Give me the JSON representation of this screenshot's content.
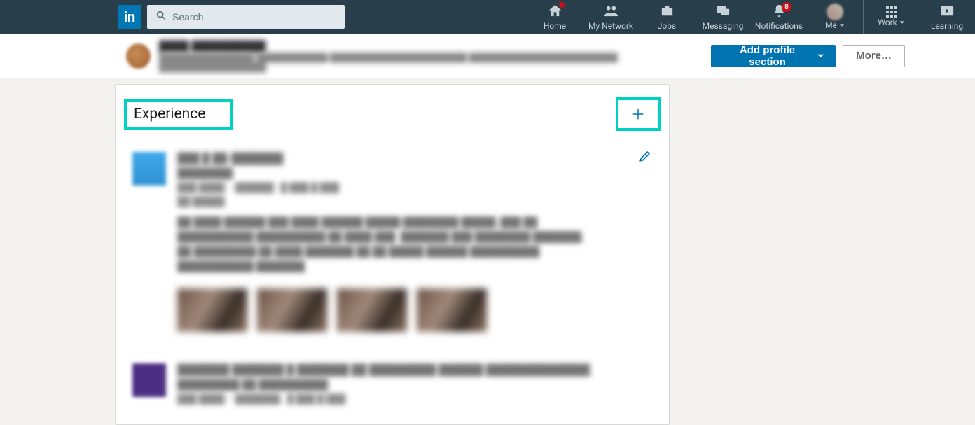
{
  "nav": {
    "logo_text": "in",
    "search_placeholder": "Search",
    "items": [
      {
        "label": "Home",
        "icon": "home-icon",
        "dot": true
      },
      {
        "label": "My Network",
        "icon": "network-icon"
      },
      {
        "label": "Jobs",
        "icon": "jobs-icon"
      },
      {
        "label": "Messaging",
        "icon": "messaging-icon"
      },
      {
        "label": "Notifications",
        "icon": "notifications-icon",
        "badge": "8"
      },
      {
        "label": "Me",
        "icon": "me-avatar",
        "caret": true
      },
      {
        "label": "Work",
        "icon": "waffle-icon",
        "caret": true,
        "sep": true
      },
      {
        "label": "Learning",
        "icon": "learning-icon"
      }
    ]
  },
  "sub": {
    "add_profile_section": "Add profile section",
    "more": "More…"
  },
  "card": {
    "title": "Experience"
  },
  "colors": {
    "brand": "#0073b1",
    "highlight": "#00D1C1",
    "nav_bg": "#283e4a"
  }
}
